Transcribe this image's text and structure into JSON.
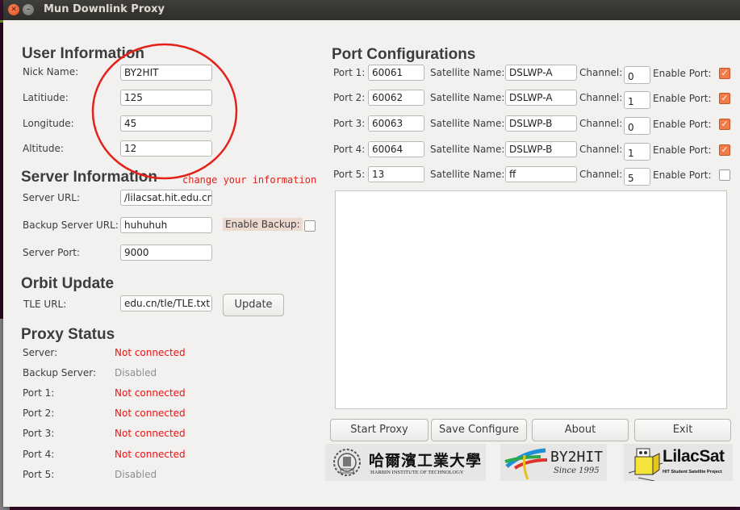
{
  "window": {
    "title": "Mun Downlink Proxy"
  },
  "user_info": {
    "heading": "User Information",
    "nick_name_label": "Nick Name:",
    "nick_name_value": "BY2HIT",
    "latitude_label": "Latitiude:",
    "latitude_value": "125",
    "longitude_label": "Longitude:",
    "longitude_value": "45",
    "altitude_label": "Altitude:",
    "altitude_value": "12"
  },
  "server_info": {
    "heading": "Server Information",
    "server_url_label": "Server URL:",
    "server_url_value": "/lilacsat.hit.edu.cn",
    "backup_url_label": "Backup Server URL:",
    "backup_url_value": "huhuhuh",
    "enable_backup_label": "Enable Backup:",
    "enable_backup_checked": false,
    "server_port_label": "Server Port:",
    "server_port_value": "9000"
  },
  "orbit_update": {
    "heading": "Orbit Update",
    "tle_url_label": "TLE URL:",
    "tle_url_value": "edu.cn/tle/TLE.txt",
    "update_button": "Update"
  },
  "proxy_status": {
    "heading": "Proxy Status",
    "rows": [
      {
        "label": "Server:",
        "value": "Not connected",
        "state": "error"
      },
      {
        "label": "Backup Server:",
        "value": "Disabled",
        "state": "disabled"
      },
      {
        "label": "Port 1:",
        "value": "Not connected",
        "state": "error"
      },
      {
        "label": "Port 2:",
        "value": "Not connected",
        "state": "error"
      },
      {
        "label": "Port 3:",
        "value": "Not connected",
        "state": "error"
      },
      {
        "label": "Port 4:",
        "value": "Not connected",
        "state": "error"
      },
      {
        "label": "Port 5:",
        "value": "Disabled",
        "state": "disabled"
      }
    ]
  },
  "port_config": {
    "heading": "Port Configurations",
    "satellite_label": "Satellite Name:",
    "channel_label": "Channel:",
    "enable_label": "Enable Port:",
    "ports": [
      {
        "label": "Port 1:",
        "port": "60061",
        "satellite": "DSLWP-A",
        "channel": "0",
        "enabled": true
      },
      {
        "label": "Port 2:",
        "port": "60062",
        "satellite": "DSLWP-A",
        "channel": "1",
        "enabled": true
      },
      {
        "label": "Port 3:",
        "port": "60063",
        "satellite": "DSLWP-B",
        "channel": "0",
        "enabled": true
      },
      {
        "label": "Port 4:",
        "port": "60064",
        "satellite": "DSLWP-B",
        "channel": "1",
        "enabled": true
      },
      {
        "label": "Port 5:",
        "port": "13",
        "satellite": "ff",
        "channel": "5",
        "enabled": false
      }
    ]
  },
  "log": {
    "content": ""
  },
  "actions": {
    "start_proxy": "Start Proxy",
    "save_configure": "Save Configure",
    "about": "About",
    "exit": "Exit"
  },
  "logos": {
    "hit_cn": "哈爾濱工業大學",
    "hit_en": "HARBIN INSTITUTE OF TECHNOLOGY",
    "by2hit_name": "BY2HIT",
    "by2hit_since": "Since 1995",
    "lilacsat_name": "LilacSat",
    "lilacsat_sub": "HIT Student Satellite Project"
  },
  "annotation": {
    "text": "change your information"
  },
  "colors": {
    "accent_checkbox": "#f27b4b",
    "error_status": "#ee1111",
    "disabled_status": "#8e8e8e",
    "annotation": "#e4201a"
  }
}
